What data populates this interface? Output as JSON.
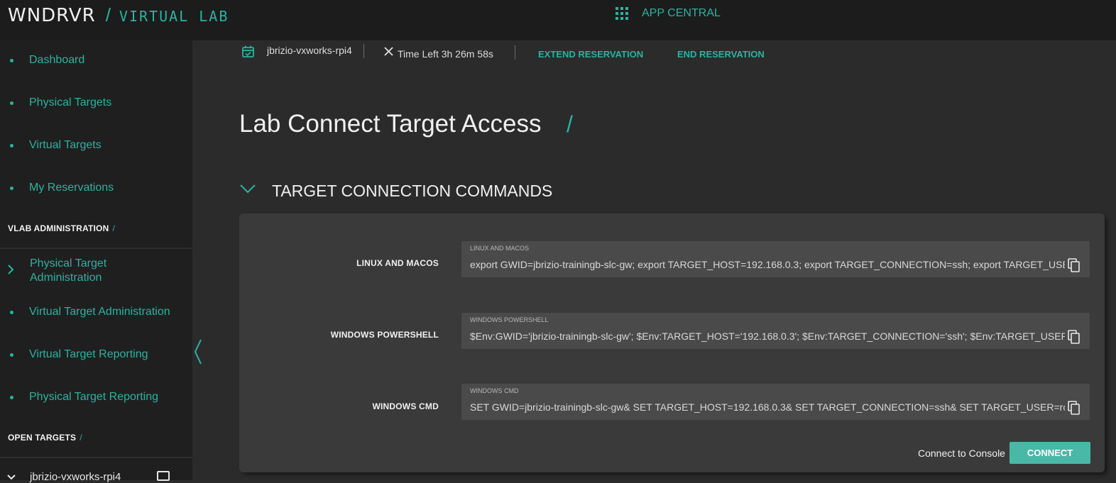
{
  "header": {
    "brand": "WNDRVR",
    "separator": "/",
    "subtitle": "VIRTUAL LAB",
    "app_central_icon": "apps-grid-icon",
    "app_central_label": "APP CENTRAL"
  },
  "sidebar": {
    "items": [
      {
        "label": "Dashboard"
      },
      {
        "label": "Physical Targets"
      },
      {
        "label": "Virtual Targets"
      },
      {
        "label": "My Reservations"
      }
    ],
    "admin_header": "VLAB ADMINISTRATION",
    "admin_items": [
      {
        "label": "Physical Target Administration"
      },
      {
        "label": "Virtual Target Administration"
      },
      {
        "label": "Virtual Target Reporting"
      },
      {
        "label": "Physical Target Reporting"
      }
    ],
    "open_targets_header": "OPEN TARGETS",
    "open_target": "jbrizio-vxworks-rpi4",
    "slash": "/"
  },
  "reservation": {
    "name": "jbrizio-vxworks-rpi4",
    "time_left": "Time Left 3h 26m 58s",
    "extend_label": "EXTEND RESERVATION",
    "end_label": "END RESERVATION"
  },
  "page": {
    "title": "Lab Connect Target Access",
    "title_slash": "/",
    "section_title": "TARGET CONNECTION COMMANDS"
  },
  "commands": [
    {
      "label": "LINUX AND MACOS",
      "caption": "LINUX AND MACOS",
      "text": "export GWID=jbrizio-trainingb-slc-gw; export TARGET_HOST=192.168.0.3; export TARGET_CONNECTION=ssh; export TARGET_USER=root"
    },
    {
      "label": "WINDOWS POWERSHELL",
      "caption": "WINDOWS POWERSHELL",
      "text": "$Env:GWID='jbrizio-trainingb-slc-gw'; $Env:TARGET_HOST='192.168.0.3'; $Env:TARGET_CONNECTION='ssh'; $Env:TARGET_USER='root'; $Env"
    },
    {
      "label": "WINDOWS CMD",
      "caption": "WINDOWS CMD",
      "text": "SET GWID=jbrizio-trainingb-slc-gw& SET TARGET_HOST=192.168.0.3& SET TARGET_CONNECTION=ssh& SET TARGET_USER=root& SET TAR"
    }
  ],
  "console": {
    "label": "Connect to Console",
    "button": "CONNECT"
  },
  "colors": {
    "accent": "#2bb3a0",
    "button": "#4ab8a6",
    "background": "#2b2b2b",
    "sidebar": "#1f1f1f",
    "topbar": "#1c1c1c",
    "card": "#3a3a3a"
  }
}
